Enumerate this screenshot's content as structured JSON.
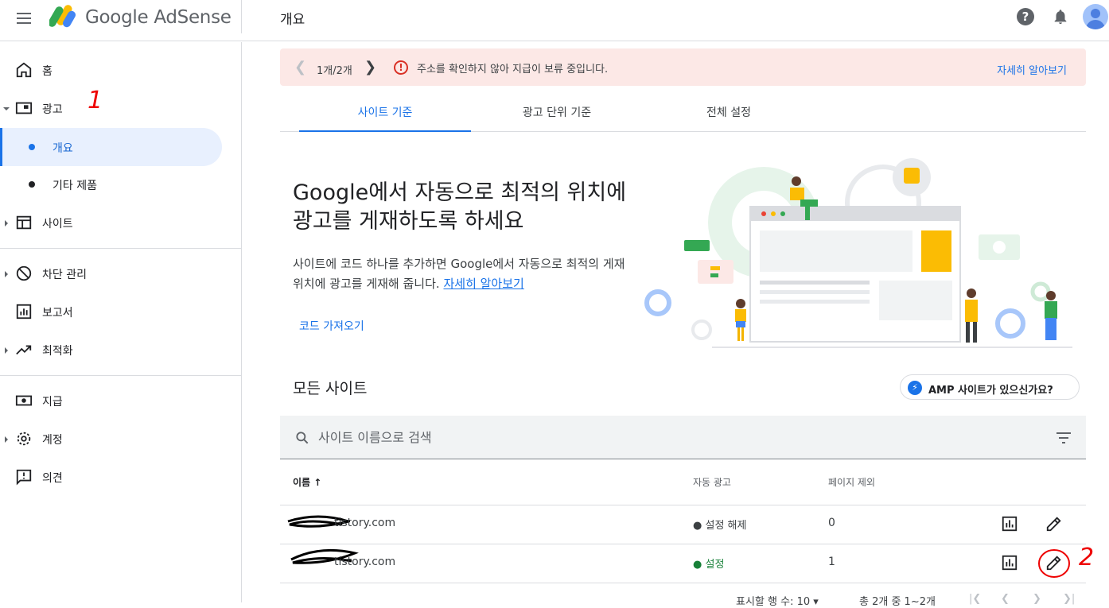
{
  "app": {
    "logo_text": "Google AdSense",
    "page_title": "개요"
  },
  "banner": {
    "counter": "1개/2개",
    "message": "주소를 확인하지 않아 지급이 보류 중입니다.",
    "link": "자세히 알아보기"
  },
  "sidebar": {
    "items": [
      {
        "label": "홈",
        "icon": "home-icon"
      },
      {
        "label": "광고",
        "icon": "ads-icon"
      },
      {
        "label": "개요"
      },
      {
        "label": "기타 제품"
      },
      {
        "label": "사이트",
        "icon": "sites-icon"
      },
      {
        "label": "차단 관리",
        "icon": "block-icon"
      },
      {
        "label": "보고서",
        "icon": "report-icon"
      },
      {
        "label": "최적화",
        "icon": "trending-icon"
      },
      {
        "label": "지급",
        "icon": "payments-icon"
      },
      {
        "label": "계정",
        "icon": "gear-icon"
      },
      {
        "label": "의견",
        "icon": "feedback-icon"
      }
    ]
  },
  "annotations": {
    "one": "1",
    "two": "2"
  },
  "tabs": [
    {
      "label": "사이트 기준"
    },
    {
      "label": "광고 단위 기준"
    },
    {
      "label": "전체 설정"
    }
  ],
  "hero": {
    "title": "Google에서 자동으로 최적의 위치에 광고를 게재하도록 하세요",
    "desc": "사이트에 코드 하나를 추가하면 Google에서 자동으로 최적의 게재위치에 광고를 게재해 줍니다.",
    "link": "자세히 알아보기",
    "cta": "코드 가져오기"
  },
  "sites": {
    "heading": "모든 사이트",
    "amp_button": "AMP 사이트가 있으신가요?",
    "search_placeholder": "사이트 이름으로 검색",
    "columns": {
      "name": "이름",
      "auto_ads": "자동 광고",
      "page_exclusion": "페이지 제외"
    },
    "rows": [
      {
        "name": "tistory.com",
        "auto_ads": "설정 해제",
        "page_exclusion": "0"
      },
      {
        "name": "tistory.com",
        "auto_ads": "설정",
        "page_exclusion": "1"
      }
    ],
    "pager": {
      "rows_label": "표시할 행 수:",
      "rows_value": "10",
      "range": "총 2개 중 1~2개"
    }
  },
  "colors": {
    "accent": "#1a73e8",
    "banner_bg": "#fce8e6",
    "error": "#d93025",
    "status_on": "#188038"
  }
}
